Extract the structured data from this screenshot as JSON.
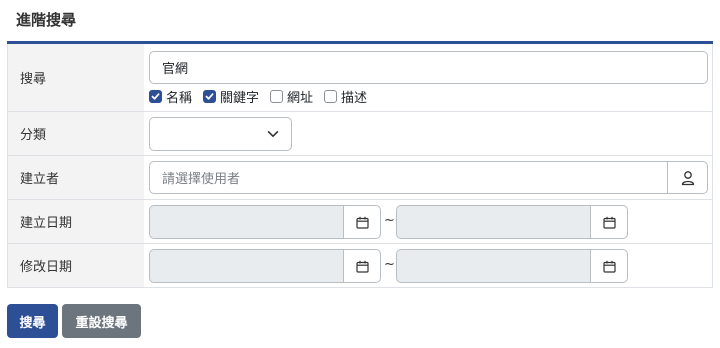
{
  "page": {
    "title": "進階搜尋"
  },
  "form": {
    "search": {
      "label": "搜尋",
      "value": "官網"
    },
    "options": [
      {
        "label": "名稱",
        "checked": true
      },
      {
        "label": "關鍵字",
        "checked": true
      },
      {
        "label": "網址",
        "checked": false
      },
      {
        "label": "描述",
        "checked": false
      }
    ],
    "category": {
      "label": "分類",
      "value": ""
    },
    "creator": {
      "label": "建立者",
      "placeholder": "請選擇使用者"
    },
    "created_date": {
      "label": "建立日期",
      "separator": "~"
    },
    "modified_date": {
      "label": "修改日期",
      "separator": "~"
    }
  },
  "actions": {
    "search_label": "搜尋",
    "reset_label": "重設搜尋"
  },
  "colors": {
    "primary": "#2d4f96",
    "secondary": "#6c757d",
    "label_bg": "#f3f3f3"
  },
  "icons": {
    "check": "check-icon",
    "chevron": "chevron-down-icon",
    "user": "user-icon",
    "calendar": "calendar-icon"
  }
}
